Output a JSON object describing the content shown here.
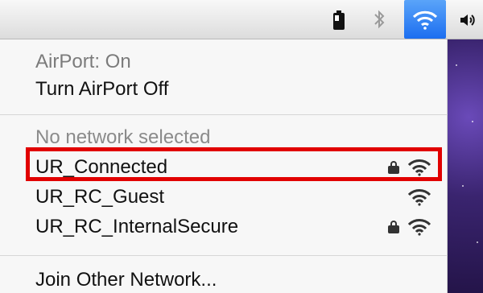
{
  "menubar": {
    "icons": {
      "battery": "battery-icon",
      "bluetooth": "bluetooth-icon",
      "wifi": "wifi-icon",
      "volume": "volume-icon"
    }
  },
  "airport_menu": {
    "status": "AirPort: On",
    "turn_off": "Turn AirPort Off",
    "no_network": "No network selected",
    "networks": [
      {
        "name": "UR_Connected",
        "secured": true,
        "highlighted": true
      },
      {
        "name": "UR_RC_Guest",
        "secured": false,
        "highlighted": false
      },
      {
        "name": "UR_RC_InternalSecure",
        "secured": true,
        "highlighted": false
      }
    ],
    "join_other": "Join Other Network..."
  },
  "colors": {
    "highlight": "#e10000",
    "wifi_active": "#1c6ef0",
    "desktop": "#3a246f"
  }
}
